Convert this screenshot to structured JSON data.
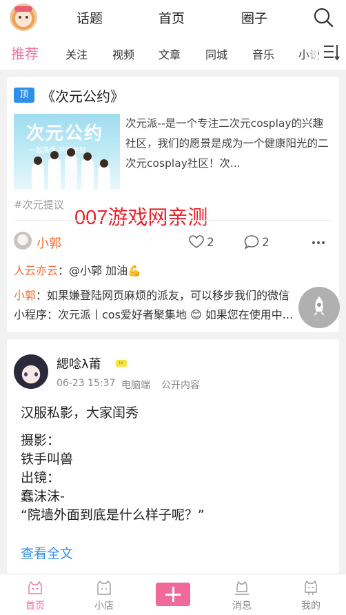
{
  "header": {
    "nav": [
      "话题",
      "首页",
      "圈子"
    ]
  },
  "tabs": [
    "推荐",
    "关注",
    "视频",
    "文章",
    "同城",
    "音乐",
    "小说"
  ],
  "card1": {
    "badge": "顶",
    "title": "《次元公约》",
    "thumb_title": "次元公约",
    "thumb_sub": "一起携手  共建美好",
    "description": "次元派--是一个专注二次元cosplay的兴趣社区，我们的愿景是成为一个健康阳光的二次元cosplay社区！次...",
    "topic": "#次元提议",
    "watermark": "007游戏网亲测",
    "author": "小郭",
    "likes": "2",
    "comments": "2",
    "comment1_user": "人云亦云",
    "comment1_text": "：@小郭 加油💪",
    "comment2_user": "小郭",
    "comment2_line1": "：如果嫌登陆网页麻烦的派友，可以移步我们的微信",
    "comment2_line2": "小程序：次元派丨cos爱好者聚集地 😊 如果您在使用中..."
  },
  "card2": {
    "user_name": "緦唸λ莆",
    "level": "LV",
    "date": "06-23 15:37",
    "device": "电脑端",
    "visibility": "公开内容",
    "lines": [
      "汉服私影，大家闺秀",
      "摄影：",
      "铁手叫兽",
      "出镜：",
      "蠢沫沫-",
      "“院墙外面到底是什么样子呢？”"
    ],
    "read_more": "查看全文"
  },
  "bottom_nav": {
    "home": "首页",
    "shop": "小店",
    "messages": "消息",
    "me": "我的"
  },
  "colors": {
    "accent": "#f26f9d",
    "orange": "#f26a2e",
    "link": "#2e8fe8",
    "watermark": "#e8202a"
  }
}
